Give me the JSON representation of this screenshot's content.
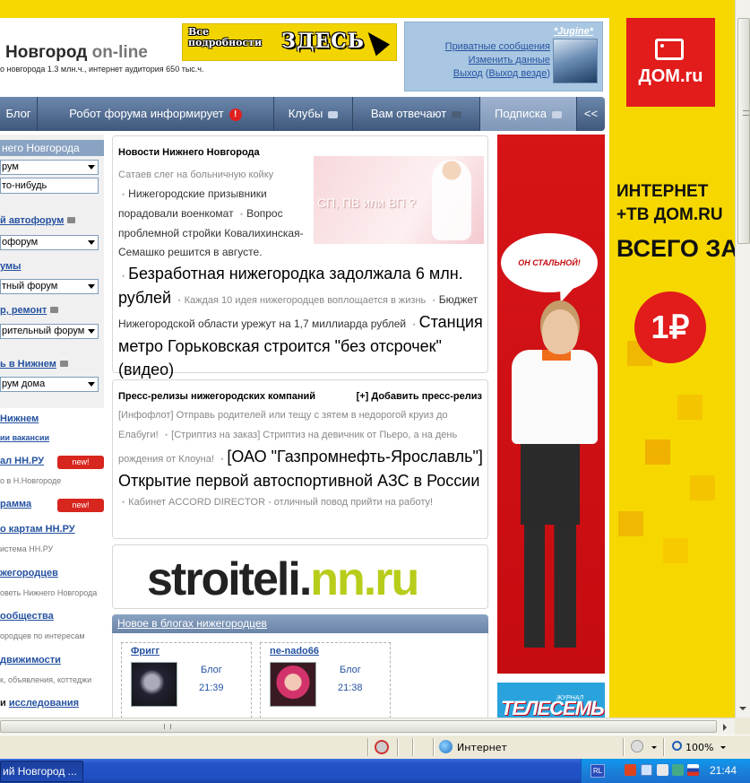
{
  "header": {
    "site_title": "Новгород",
    "site_title_suffix": "on-line",
    "site_desc": "о новгорода 1.3 млн.ч., интернет аудитория 650 тыс.ч.",
    "promo_small": "Все подробности",
    "promo_big": "ЗДЕСЬ"
  },
  "user_box": {
    "username": "*Jugine*",
    "links": [
      "Приватные сообщения",
      "Изменить данные"
    ],
    "logout": "Выход",
    "logout_everywhere": "Выход везде"
  },
  "nav": {
    "items": [
      {
        "label": "Блог"
      },
      {
        "label": "Робот форума информирует"
      },
      {
        "label": "Клубы"
      },
      {
        "label": "Вам отвечают"
      },
      {
        "label": "Подписка"
      },
      {
        "label": "<<"
      }
    ]
  },
  "left": {
    "header": "него Новгорода",
    "select1": "рум",
    "input1": "то-нибудь",
    "link1": "й автофорум",
    "select2": "офорум",
    "link2": "умы",
    "select3": "тный форум",
    "link3": "р, ремонт",
    "select4": "рительный форум",
    "link4": "ь в Нижнем",
    "select5": "рум дома",
    "link5": "Нижнем",
    "link5_sub_a": "ии",
    "link5_sub_b": "вакансии",
    "link6": "ал НН.РУ",
    "link6_sub": "о в Н.Новгороде",
    "link7": "рамма",
    "link8": "о картам НН.РУ",
    "link8_sub": "истема НН.РУ",
    "link9": "жегородцев",
    "link9_sub": "оветь Нижнего Новгорода",
    "link10": "ообщества",
    "link10_sub": "ородцев по интересам",
    "link11": "движимости",
    "link11_sub": "к, объявления, коттеджи",
    "link12_prefix": "и",
    "link12": "исследования",
    "new_badge": "new!"
  },
  "news": {
    "title": "Новости Нижнего Новгорода",
    "subtitle": "Сатаев слег на больничную койку",
    "image_caption": "СП, ПВ или ВП ?",
    "item1": "Нижегородские призывники порадовали военкомат",
    "item2": "Вопрос проблемной стройки Ковалихинская-Семашко решится в августе.",
    "big1": "Безработная нижегородка задолжала 6 млн. рублей",
    "item3": "Каждая 10 идея нижегородцев воплощается в жизнь",
    "item4": "Бюджет Нижегородской области урежут на 1,7 миллиарда рублей",
    "big2": "Станция метро Горьковская строится \"без отсрочек\" (видео)"
  },
  "press": {
    "title": "Пресс-релизы нижегородских компаний",
    "add": "[+] Добавить пресс-релиз",
    "item1": "[Инфофлот] Отправь родителей или тещу с зятем в недорогой круиз до Елабуги!",
    "item2": "[Стриптиз на заказ] Стриптиз на девичник от Пьеро, а на день рождения от Клоуна!",
    "big1": "[ОАО \"Газпромнефть-Ярославль\"] Открытие первой автоспортивной АЗС в России",
    "item3": "Кабинет ACCORD DIRECTOR - отличный повод прийти на работу!"
  },
  "stroiteli": {
    "dark": "stroiteli.",
    "lime": "nn.ru"
  },
  "blogs": {
    "title": "Новое в блогах нижегородцев",
    "cards": [
      {
        "name": "Фригг",
        "type": "Блог",
        "time": "21:39"
      },
      {
        "name": "ne-nado66",
        "type": "Блог",
        "time": "21:38"
      }
    ]
  },
  "ads": {
    "woman_bubble": "ОН СТАЛЬНОЙ!",
    "tele_magazine": "ЖУРНАЛ",
    "tele_name": "ТЕЛЕСЕМЬ",
    "dom_logo": "ДОМ.ru",
    "dom_line1": "ИНТЕРНЕТ",
    "dom_line2": "+ТВ ДОМ.RU",
    "dom_line3": "ВСЕГО ЗА",
    "dom_price": "1₽"
  },
  "statusbar": {
    "zone": "Интернет",
    "zoom": "100%"
  },
  "taskbar": {
    "task_label": "ий Новгород ...",
    "lang": "RL",
    "clock": "21:44"
  }
}
